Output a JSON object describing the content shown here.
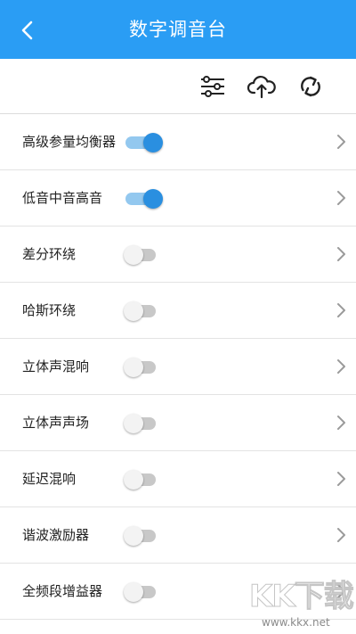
{
  "header": {
    "title": "数字调音台",
    "back_icon": "chevron-left-icon",
    "background_color": "#2a9df4"
  },
  "toolbar": {
    "buttons": [
      {
        "icon": "equalizer-sliders-icon"
      },
      {
        "icon": "cloud-upload-icon"
      },
      {
        "icon": "refresh-icon"
      }
    ]
  },
  "effects": [
    {
      "label": "高级参量均衡器",
      "enabled": true
    },
    {
      "label": "低音中音高音",
      "enabled": true
    },
    {
      "label": "差分环绕",
      "enabled": false
    },
    {
      "label": "哈斯环绕",
      "enabled": false
    },
    {
      "label": "立体声混响",
      "enabled": false
    },
    {
      "label": "立体声声场",
      "enabled": false
    },
    {
      "label": "延迟混响",
      "enabled": false
    },
    {
      "label": "谐波激励器",
      "enabled": false
    },
    {
      "label": "全频段增益器",
      "enabled": false
    }
  ],
  "watermark": {
    "logo_text": "KK下载",
    "url": "www.kkx.net"
  },
  "colors": {
    "switch_on_thumb": "#2a8fe0",
    "switch_on_track": "#93c8ef",
    "switch_off_thumb": "#f3f3f3",
    "switch_off_track": "#c8c8c8"
  }
}
